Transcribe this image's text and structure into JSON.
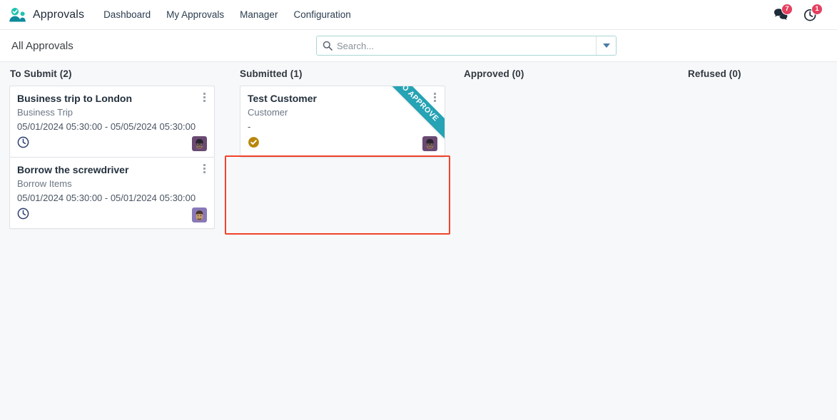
{
  "navbar": {
    "brand": "Approvals",
    "logo_icon": "approvals-app-icon",
    "menu_items": [
      {
        "label": "Dashboard",
        "name": "dashboard"
      },
      {
        "label": "My Approvals",
        "name": "my-approvals"
      },
      {
        "label": "Manager",
        "name": "manager"
      },
      {
        "label": "Configuration",
        "name": "configuration"
      }
    ],
    "systray": {
      "messages": {
        "icon": "messages-icon",
        "count": "7"
      },
      "activities": {
        "icon": "clock-activity-icon",
        "count": "1"
      }
    }
  },
  "control_panel": {
    "breadcrumb": "All Approvals",
    "search": {
      "placeholder": "Search...",
      "value": "",
      "icon": "search-icon",
      "toggle_icon": "chevron-down-icon"
    }
  },
  "kanban": {
    "columns": [
      {
        "name": "to-submit",
        "title": "To Submit (2)",
        "cards": [
          {
            "title": "Business trip to London",
            "category": "Business Trip",
            "dates": "05/01/2024 05:30:00 - 05/05/2024 05:30:00",
            "status_icon": "clock-icon",
            "status_color": "#2c3e6b",
            "avatar": "avatar-dark-hair-glasses",
            "ribbon": null
          },
          {
            "title": "Borrow the screwdriver",
            "category": "Borrow Items",
            "dates": "05/01/2024 05:30:00 - 05/01/2024 05:30:00",
            "status_icon": "clock-icon",
            "status_color": "#2c3e6b",
            "avatar": "avatar-beard-light",
            "ribbon": null
          }
        ]
      },
      {
        "name": "submitted",
        "title": "Submitted (1)",
        "highlighted": true,
        "cards": [
          {
            "title": "Test Customer",
            "category": "Customer",
            "dates": "-",
            "status_icon": "check-circle-icon",
            "status_color": "#b8860b",
            "avatar": "avatar-dark-hair-glasses",
            "ribbon": "TO APPROVE"
          }
        ]
      },
      {
        "name": "approved",
        "title": "Approved (0)",
        "cards": []
      },
      {
        "name": "refused",
        "title": "Refused (0)",
        "cards": []
      }
    ]
  },
  "colors": {
    "brand_teal": "#26a3b4",
    "badge_red": "#e4405f",
    "highlight_red": "#f0422a",
    "ribbon_teal": "#26a3b4",
    "page_bg": "#f7f8fa",
    "status_gold": "#b8860b"
  }
}
